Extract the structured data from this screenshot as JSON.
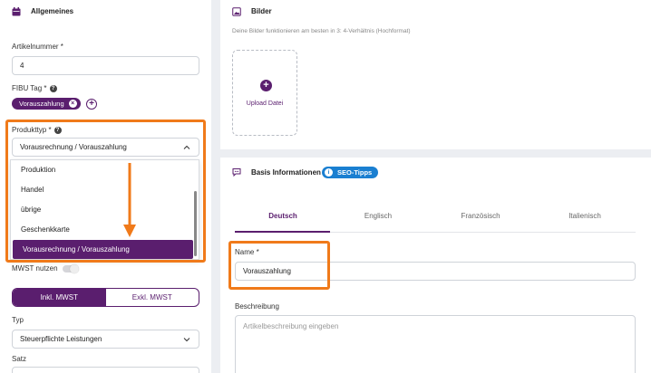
{
  "left": {
    "section_title": "Allgemeines",
    "artikelnummer": {
      "label": "Artikelnummer *",
      "value": "4"
    },
    "fibu_tag": {
      "label": "FIBU Tag *",
      "help": "?",
      "chip": "Vorauszahlung",
      "add": "+"
    },
    "produkttyp": {
      "label": "Produkttyp *",
      "help": "?",
      "value": "Vorausrechnung / Vorauszahlung",
      "options": [
        "Produktion",
        "Handel",
        "übrige",
        "Geschenkkarte",
        "Vorausrechnung / Vorauszahlung"
      ],
      "selected_index": 4
    },
    "mwst_nutzen": {
      "label": "MWST nutzen",
      "enabled": false
    },
    "mwst_mode": {
      "inkl": "Inkl. MWST",
      "exkl": "Exkl. MWST",
      "active": "inkl"
    },
    "typ": {
      "label": "Typ",
      "value": "Steuerpflichte Leistungen"
    },
    "satz": {
      "label": "Satz"
    }
  },
  "bilder": {
    "title": "Bilder",
    "hint": "Deine Bilder funktionieren am besten in 3: 4-Verhältnis (Hochformat)",
    "upload_label": "Upload Datei"
  },
  "basis": {
    "title": "Basis Informationen",
    "seo_badge": "SEO-Tipps",
    "tabs": [
      "Deutsch",
      "Englisch",
      "Französisch",
      "Italienisch"
    ],
    "active_tab": 0,
    "name": {
      "label": "Name *",
      "value": "Vorauszahlung"
    },
    "beschreibung": {
      "label": "Beschreibung",
      "placeholder": "Artikelbeschreibung eingeben"
    }
  },
  "colors": {
    "brand": "#5a1e6e",
    "highlight": "#f07a1a",
    "info": "#1a7fd1"
  }
}
